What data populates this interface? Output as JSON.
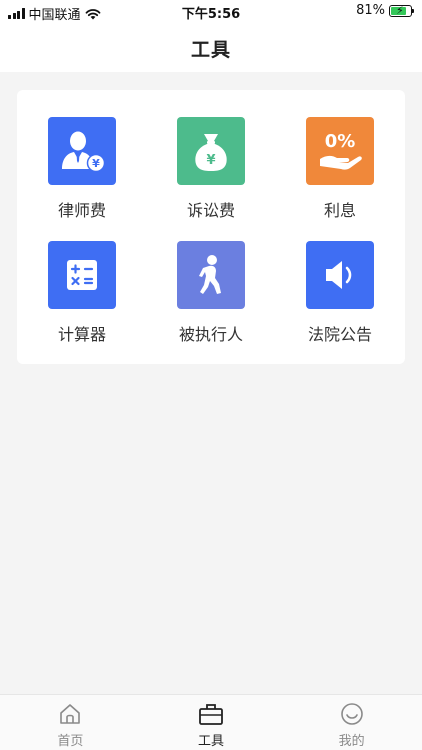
{
  "status_bar": {
    "carrier": "中国联通",
    "time": "下午5:56",
    "battery_percent": "81%",
    "battery_level": 0.81,
    "battery_color": "#34c759"
  },
  "nav": {
    "title": "工具"
  },
  "tools": [
    {
      "label": "律师费",
      "icon": "lawyer-fee-icon",
      "color": "#3f6ef3"
    },
    {
      "label": "诉讼费",
      "icon": "money-bag-icon",
      "color": "#4dbb8c"
    },
    {
      "label": "利息",
      "icon": "interest-percent-icon",
      "color": "#f0883a"
    },
    {
      "label": "计算器",
      "icon": "calculator-icon",
      "color": "#3f6ef3"
    },
    {
      "label": "被执行人",
      "icon": "walking-person-icon",
      "color": "#6b7fe0"
    },
    {
      "label": "法院公告",
      "icon": "speaker-icon",
      "color": "#3f6ef3"
    }
  ],
  "tab_bar": {
    "items": [
      {
        "label": "首页",
        "icon": "home-icon",
        "active": false
      },
      {
        "label": "工具",
        "icon": "briefcase-icon",
        "active": true
      },
      {
        "label": "我的",
        "icon": "smiley-icon",
        "active": false
      }
    ]
  }
}
